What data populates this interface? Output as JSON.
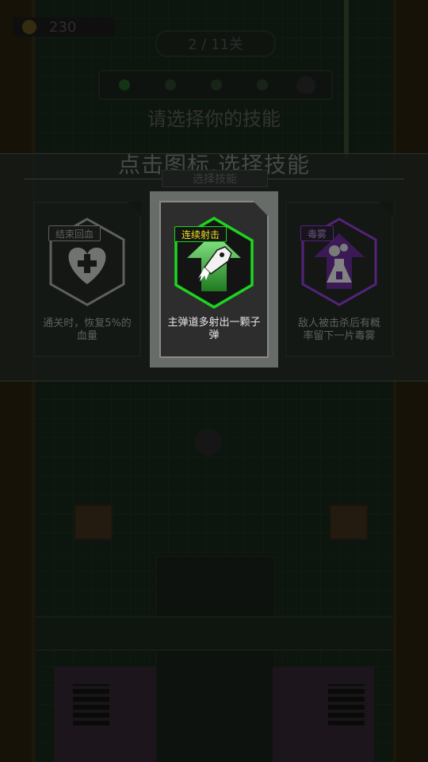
{
  "hud": {
    "coins": "230",
    "level": "2 / 11关"
  },
  "background": {
    "dim_prompt": "请选择你的技能"
  },
  "overlay": {
    "hint": "点击图标,选择技能",
    "panel_tab": "选择技能"
  },
  "skills": [
    {
      "name": "结束回血",
      "description": "通关时，恢复5%的血量",
      "icon": "heart-cross-icon",
      "color": "#9a9a9a",
      "selected": false
    },
    {
      "name": "连续射击",
      "description": "主弹道多射出一颗子弹",
      "icon": "rocket-arrow-icon",
      "color": "#1ed41e",
      "selected": true
    },
    {
      "name": "毒雾",
      "description": "敌人被击杀后有概率留下一片毒雾",
      "icon": "poison-flask-icon",
      "color": "#8a2bd2",
      "selected": false
    }
  ]
}
